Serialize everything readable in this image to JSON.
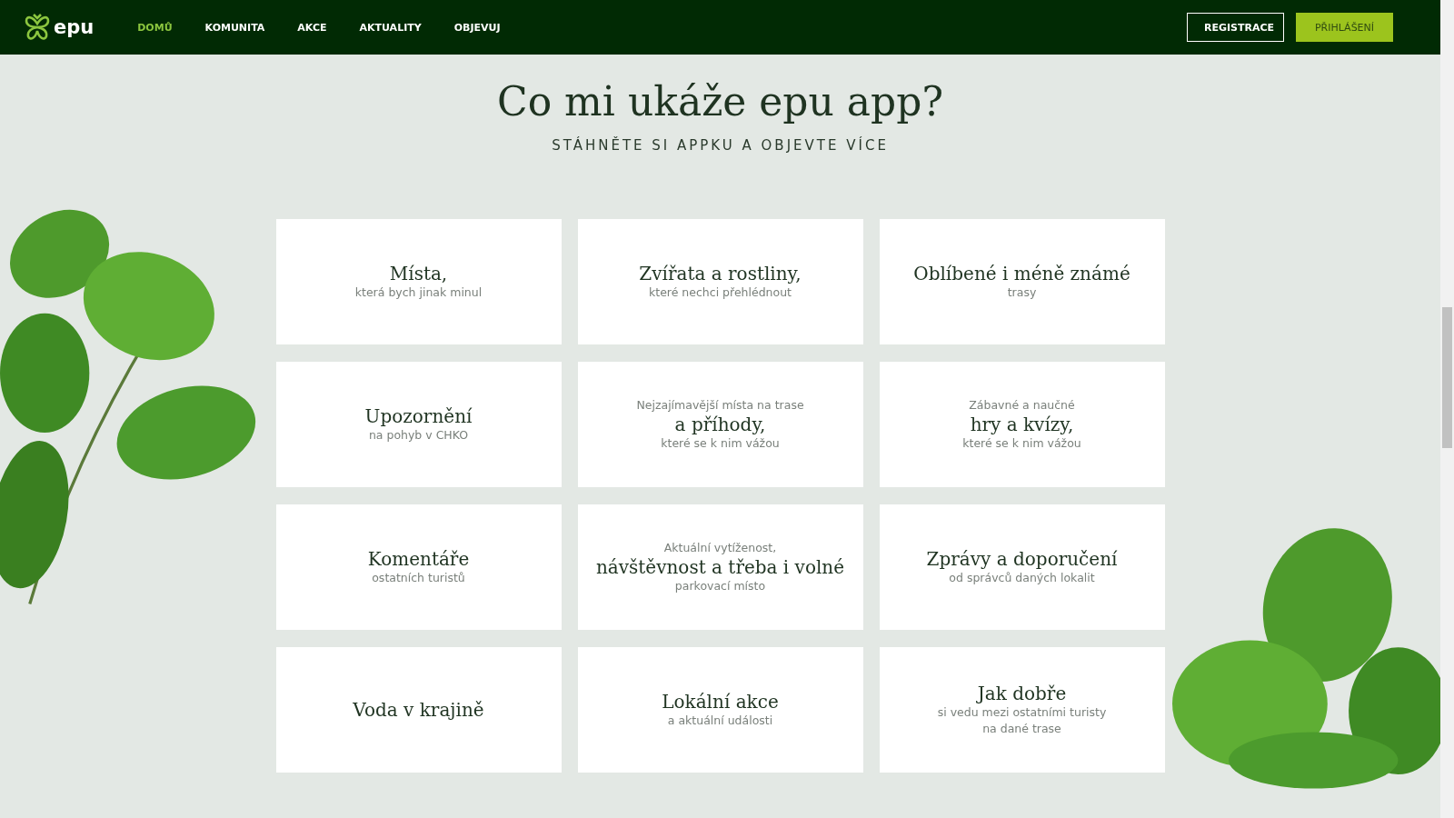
{
  "header": {
    "logo": "epu",
    "nav": [
      {
        "label": "DOMŮ",
        "selected": true
      },
      {
        "label": "KOMUNITA",
        "selected": false
      },
      {
        "label": "AKCE",
        "selected": false
      },
      {
        "label": "AKTUALITY",
        "selected": false
      },
      {
        "label": "OBJEVUJ",
        "selected": false
      }
    ],
    "buttons": [
      {
        "label": "REGISTRACE",
        "kind": "outline"
      },
      {
        "label": "PŘIHLÁŠENÍ",
        "kind": "filled"
      }
    ]
  },
  "heading": "Co mi ukáže epu app?",
  "subheading": "STÁHNĚTE SI APPKU A OBJEVTE VÍCE",
  "cards": [
    {
      "lines": [
        {
          "kind": "title",
          "text": "Místa,"
        },
        {
          "kind": "note",
          "text": "která bych jinak minul"
        }
      ]
    },
    {
      "lines": [
        {
          "kind": "title",
          "text": "Zvířata a rostliny,"
        },
        {
          "kind": "note",
          "text": "které nechci přehlédnout"
        }
      ]
    },
    {
      "lines": [
        {
          "kind": "title",
          "text": "Oblíbené i méně známé"
        },
        {
          "kind": "note",
          "text": "trasy"
        }
      ]
    },
    {
      "lines": [
        {
          "kind": "title",
          "text": "Upozornění"
        },
        {
          "kind": "note",
          "text": "na pohyb v CHKO"
        }
      ]
    },
    {
      "lines": [
        {
          "kind": "note",
          "text": "Nejzajímavější místa na trase"
        },
        {
          "kind": "title",
          "text": "a příhody,"
        },
        {
          "kind": "note",
          "text": "které se k nim vážou"
        }
      ]
    },
    {
      "lines": [
        {
          "kind": "note",
          "text": "Zábavné a naučné"
        },
        {
          "kind": "title",
          "text": "hry a kvízy,"
        },
        {
          "kind": "note",
          "text": "které se k nim vážou"
        }
      ]
    },
    {
      "lines": [
        {
          "kind": "title",
          "text": "Komentáře"
        },
        {
          "kind": "note",
          "text": "ostatních turistů"
        }
      ]
    },
    {
      "lines": [
        {
          "kind": "note",
          "text": "Aktuální vytíženost,"
        },
        {
          "kind": "title",
          "text": "návštěvnost a třeba i volné"
        },
        {
          "kind": "note",
          "text": "parkovací místo"
        }
      ]
    },
    {
      "lines": [
        {
          "kind": "title",
          "text": "Zprávy a doporučení"
        },
        {
          "kind": "note",
          "text": "od správců daných lokalit"
        }
      ]
    },
    {
      "lines": [
        {
          "kind": "title",
          "text": "Voda v krajině"
        }
      ]
    },
    {
      "lines": [
        {
          "kind": "title",
          "text": "Lokální akce"
        },
        {
          "kind": "note",
          "text": "a aktuální události"
        }
      ]
    },
    {
      "lines": [
        {
          "kind": "title",
          "text": "Jak dobře"
        },
        {
          "kind": "note",
          "text": "si vedu mezi ostatními turisty"
        },
        {
          "kind": "note",
          "text": "na dané trase"
        }
      ]
    }
  ]
}
